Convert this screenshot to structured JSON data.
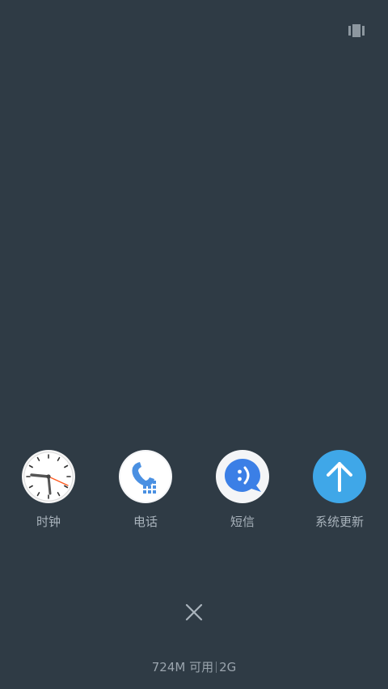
{
  "toolbar": {
    "view_toggle_icon": "view-toggle-icon"
  },
  "recent_apps": [
    {
      "label": "时钟",
      "icon": "clock-icon"
    },
    {
      "label": "电话",
      "icon": "phone-icon"
    },
    {
      "label": "短信",
      "icon": "messages-icon"
    },
    {
      "label": "系统更新",
      "icon": "system-update-icon"
    }
  ],
  "close_button": {
    "icon": "close-icon"
  },
  "memory_status": {
    "available": "724M 可用",
    "total": "2G"
  },
  "colors": {
    "background": "#2f3b45",
    "label": "#a9b3bc",
    "phone_blue": "#4a90e2",
    "message_blue": "#3b7fe6",
    "update_blue": "#3fa7e8"
  }
}
